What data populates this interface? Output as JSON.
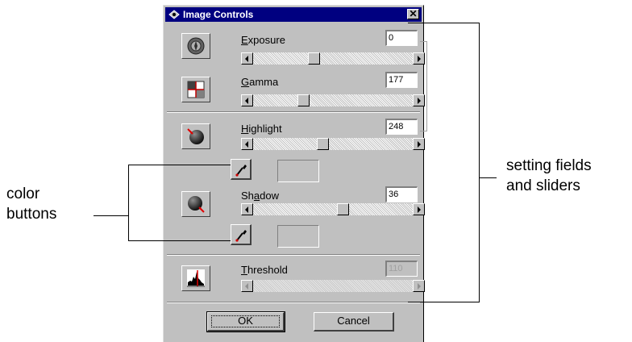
{
  "window": {
    "title": "Image Controls",
    "close_glyph": "✕",
    "app_icon": "eye-scan-icon"
  },
  "controls": {
    "exposure": {
      "label_mnemonic": "E",
      "label_rest": "xposure",
      "value": "0",
      "slider_fraction": 0.37,
      "icon": "exposure-icon"
    },
    "gamma": {
      "label_mnemonic": "G",
      "label_rest": "amma",
      "value": "177",
      "slider_fraction": 0.3,
      "icon": "gamma-icon"
    },
    "highlight": {
      "label_mnemonic": "H",
      "label_rest": "ighlight",
      "value": "248",
      "slider_fraction": 0.43,
      "icon": "highlight-icon"
    },
    "shadow": {
      "label_pre": "Sh",
      "label_mnemonic": "a",
      "label_rest": "dow",
      "value": "36",
      "slider_fraction": 0.57,
      "icon": "shadow-icon"
    },
    "threshold": {
      "label_mnemonic": "T",
      "label_rest": "hreshold",
      "value": "110",
      "disabled": true,
      "icon": "threshold-icon"
    }
  },
  "buttons": {
    "ok": "OK",
    "cancel": "Cancel"
  },
  "annotations": {
    "color_buttons_line1": "color",
    "color_buttons_line2": "buttons",
    "setting_fields_line1": "setting fields",
    "setting_fields_line2": "and sliders"
  },
  "colors": {
    "titlebar": "#000080",
    "dialog": "#c0c0c0",
    "eyedropper_tip": "#d00000"
  }
}
